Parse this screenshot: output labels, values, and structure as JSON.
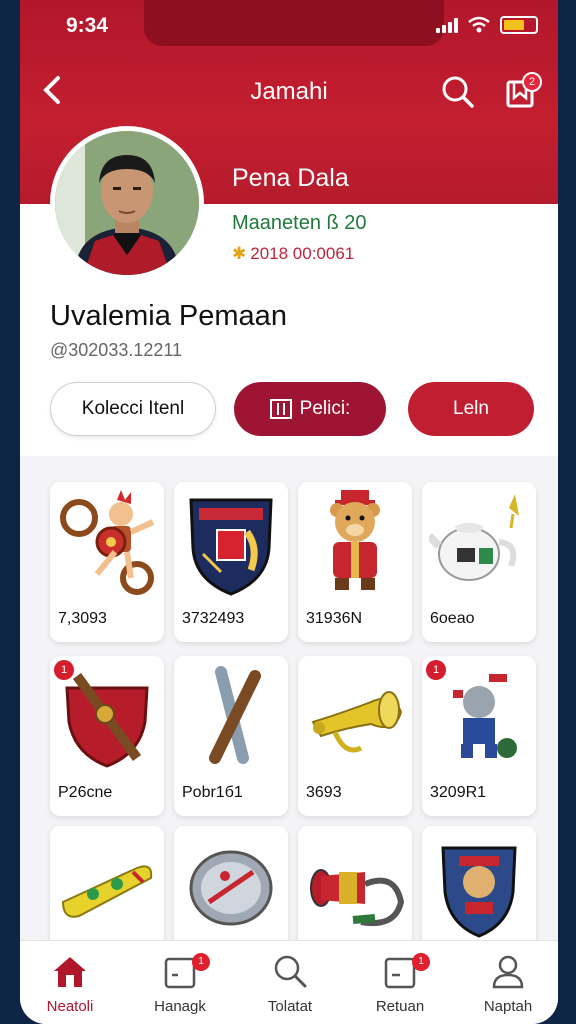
{
  "status": {
    "time": "9:34"
  },
  "header": {
    "title": "Jamahi",
    "back_icon": "chevron-left-icon",
    "search_icon": "search-icon",
    "notif_icon": "bookmark-icon",
    "notif_count": "2"
  },
  "profile": {
    "name": "Pena Dala",
    "meta": "Maaneten ß 20",
    "date": "2018 00:0061",
    "display_name": "Uvalemia Pemaan",
    "handle": "@302033.12211"
  },
  "actions": {
    "collection_label": "Kolecci Itenl",
    "primary_label": "Pelici:",
    "secondary_label": "Leln"
  },
  "items": [
    {
      "label": "7,3093",
      "icon": "warrior-toy-icon",
      "badge": null
    },
    {
      "label": "3732493",
      "icon": "shield-crest-icon",
      "badge": null
    },
    {
      "label": "31936N",
      "icon": "bear-mascot-icon",
      "badge": null
    },
    {
      "label": "6oeao",
      "icon": "teapot-icon",
      "badge": null
    },
    {
      "label": "P26cne",
      "icon": "red-shield-icon",
      "badge": "1"
    },
    {
      "label": "Pobr1б1",
      "icon": "crossed-sticks-icon",
      "badge": null
    },
    {
      "label": "3693",
      "icon": "golden-horn-icon",
      "badge": null
    },
    {
      "label": "3209R1",
      "icon": "robot-figure-icon",
      "badge": "1"
    },
    {
      "label": "",
      "icon": "scarf-icon",
      "badge": null
    },
    {
      "label": "",
      "icon": "badge-pin-icon",
      "badge": null
    },
    {
      "label": "",
      "icon": "trumpet-icon",
      "badge": null
    },
    {
      "label": "",
      "icon": "mascot-crest-icon",
      "badge": null
    }
  ],
  "nav": [
    {
      "label": "Neatoli",
      "icon": "home-icon",
      "active": true
    },
    {
      "label": "Hanagk",
      "icon": "calendar-icon",
      "badge": "1"
    },
    {
      "label": "Tolatat",
      "icon": "search-icon"
    },
    {
      "label": "Retuan",
      "icon": "calendar-icon",
      "badge": "1"
    },
    {
      "label": "Naptah",
      "icon": "user-icon"
    }
  ],
  "colors": {
    "brand": "#b3162b",
    "accent_dark": "#9e1433",
    "accent_red": "#c01f31"
  }
}
